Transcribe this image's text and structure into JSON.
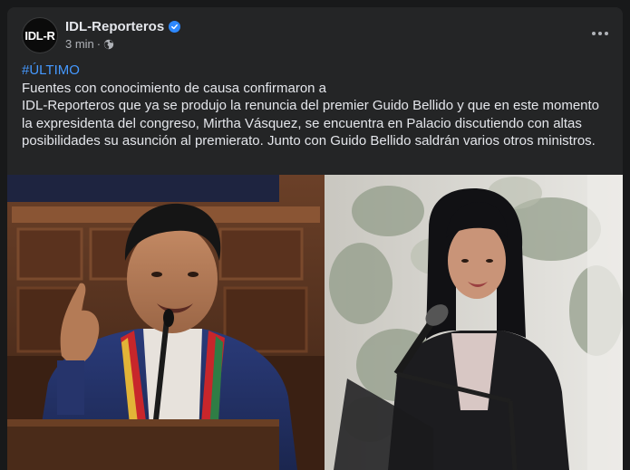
{
  "post": {
    "page_name": "IDL-Reporteros",
    "avatar_text": "IDL-R",
    "verified_icon": "verified-badge-icon",
    "time": "3 min",
    "separator": "·",
    "privacy_icon": "globe-icon",
    "more_icon": "more-options-icon",
    "hashtag": "#ÚLTIMO",
    "body_line1": "Fuentes con conocimiento de causa confirmaron a",
    "body_rest": "IDL-Reporteros que ya se produjo la renuncia del premier Guido Bellido y que en este momento la expresidenta del congreso, Mirtha Vásquez, se encuentra en Palacio discutiendo con altas posibilidades su asunción al premierato. Junto con Guido Bellido saldrán varios otros ministros."
  },
  "colors": {
    "page_bg": "#18191a",
    "card_bg": "#242526",
    "text_primary": "#e4e6eb",
    "text_secondary": "#b0b3b8",
    "link": "#4599ff",
    "verified": "#2d88ff"
  }
}
